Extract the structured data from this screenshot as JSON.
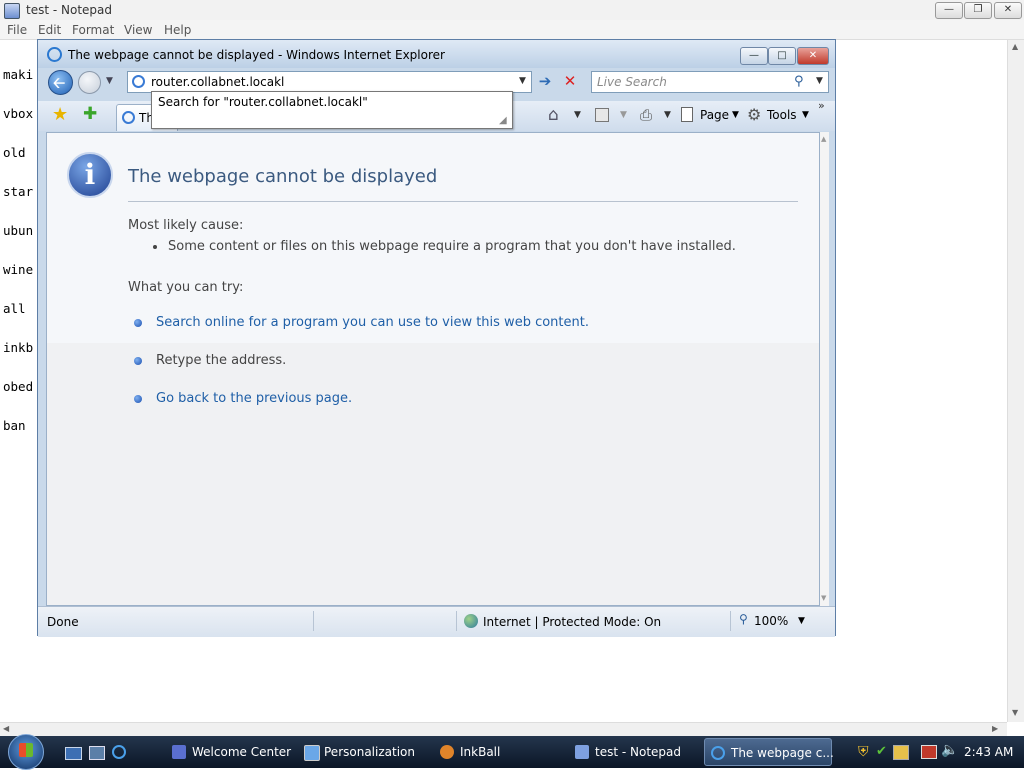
{
  "notepad": {
    "title": "test - Notepad",
    "menu": [
      "File",
      "Edit",
      "Format",
      "View",
      "Help"
    ],
    "lines": [
      "maki",
      "vbox",
      "old ",
      "star",
      "ubun",
      "wine",
      "all ",
      "inkb",
      "obed",
      "ban "
    ]
  },
  "ie": {
    "title": "The webpage cannot be displayed - Windows Internet Explorer",
    "address_value": "router.collabnet.locakl",
    "suggestion": "Search for \"router.collabnet.locakl\"",
    "search_placeholder": "Live Search",
    "tab_label": "Th",
    "page_menu": "Page",
    "tools_menu": "Tools",
    "page": {
      "heading": "The webpage cannot be displayed",
      "cause_label": "Most likely cause:",
      "cause_item": "Some content or files on this webpage require a program that you don't have installed.",
      "try_label": "What you can try:",
      "actions": [
        "Search online for a program you can use to view this web content.",
        "Retype the address.",
        "Go back to the previous page."
      ]
    },
    "status": {
      "left": "Done",
      "zone": "Internet | Protected Mode: On",
      "zoom": "100%"
    }
  },
  "taskbar": {
    "items": [
      "Welcome Center",
      "Personalization",
      "InkBall",
      "test - Notepad",
      "The webpage c..."
    ],
    "clock": "2:43 AM"
  },
  "colors": {
    "link": "#1f5fa7",
    "heading": "#3b5a80",
    "taskbar": "#14233a"
  }
}
